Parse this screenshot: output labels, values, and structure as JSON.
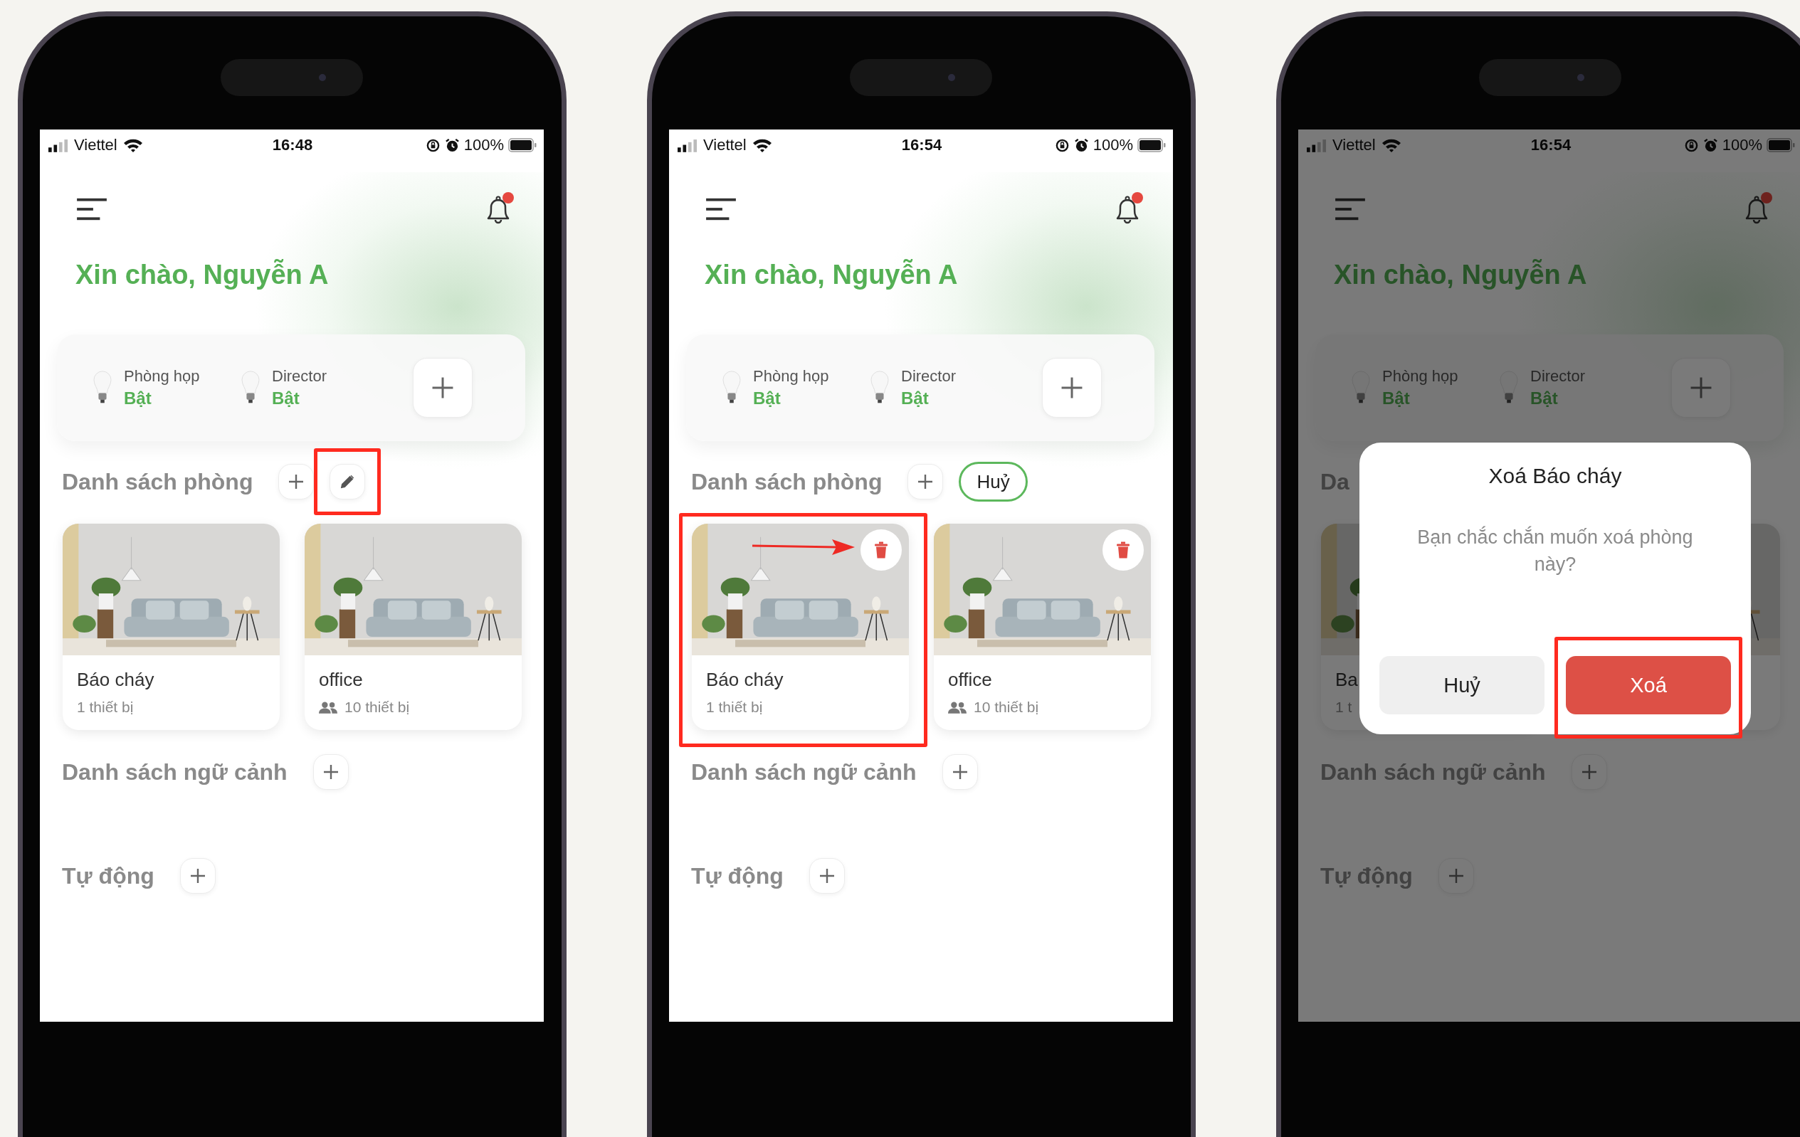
{
  "phones": [
    {
      "status_bar": {
        "carrier": "Viettel",
        "time": "16:48",
        "battery": "100%"
      },
      "greeting": "Xin chào, Nguyễn A",
      "devices": [
        {
          "name": "Phòng họp",
          "state": "Bật"
        },
        {
          "name": "Director",
          "state": "Bật"
        }
      ],
      "room_section": {
        "title": "Danh sách phòng",
        "actions": [
          {
            "kind": "add"
          },
          {
            "kind": "edit",
            "highlighted": true
          }
        ]
      },
      "rooms": [
        {
          "kind": "room",
          "name": "Báo cháy",
          "devices": "1 thiết bị",
          "shared": false,
          "deletable": false,
          "arrow": false
        },
        {
          "kind": "room",
          "name": "office",
          "devices": "10 thiết bị",
          "shared": true,
          "deletable": false,
          "arrow": false
        }
      ],
      "sections": [
        {
          "title": "Danh sách ngữ cảnh"
        },
        {
          "title": "Tự động"
        }
      ]
    },
    {
      "status_bar": {
        "carrier": "Viettel",
        "time": "16:54",
        "battery": "100%"
      },
      "greeting": "Xin chào, Nguyễn A",
      "devices": [
        {
          "name": "Phòng họp",
          "state": "Bật"
        },
        {
          "name": "Director",
          "state": "Bật"
        }
      ],
      "room_section": {
        "title": "Danh sách phòng",
        "actions": [
          {
            "kind": "add"
          },
          {
            "kind": "cancel",
            "label": "Huỷ"
          }
        ]
      },
      "rooms": [
        {
          "kind": "room",
          "name": "Báo cháy",
          "devices": "1 thiết bị",
          "shared": false,
          "deletable": true,
          "highlighted": true,
          "arrow": true
        },
        {
          "kind": "room",
          "name": "office",
          "devices": "10 thiết bị",
          "shared": true,
          "deletable": true,
          "arrow": false
        }
      ],
      "sections": [
        {
          "title": "Danh sách ngữ cảnh"
        },
        {
          "title": "Tự động"
        }
      ]
    },
    {
      "status_bar": {
        "carrier": "Viettel",
        "time": "16:54",
        "battery": "100%"
      },
      "greeting": "Xin chào, Nguyễn A",
      "devices": [
        {
          "name": "Phòng họp",
          "state": "Bật"
        },
        {
          "name": "Director",
          "state": "Bật"
        }
      ],
      "room_section": {
        "title": "Da"
      },
      "rooms": [
        {
          "kind": "room",
          "name": "Ba",
          "devices": "1 t",
          "shared": false
        },
        {
          "kind": "picture"
        }
      ],
      "sections": [
        {
          "title": "Danh sách ngữ cảnh"
        },
        {
          "title": "Tự động"
        }
      ],
      "dimmed": true,
      "dialog": {
        "title": "Xoá Báo cháy",
        "message": "Bạn chắc chắn muốn xoá phòng này?",
        "buttons": [
          {
            "kind": "cancel",
            "label": "Huỷ"
          },
          {
            "kind": "delete",
            "label": "Xoá",
            "highlighted": true
          }
        ]
      }
    }
  ]
}
